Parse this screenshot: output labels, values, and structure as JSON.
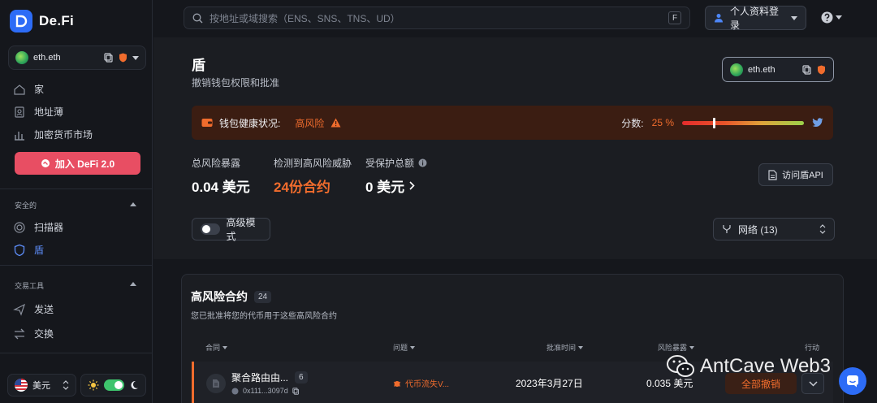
{
  "brand": {
    "name": "De.Fi"
  },
  "account": {
    "name": "eth.eth"
  },
  "search": {
    "placeholder": "按地址或域搜索（ENS、SNS、TNS、UD）",
    "shortcut": "F"
  },
  "header": {
    "login_label": "个人资料登录"
  },
  "sidebar": {
    "nav": [
      {
        "label": "家",
        "icon": "home-icon"
      },
      {
        "label": "地址薄",
        "icon": "address-book-icon"
      },
      {
        "label": "加密货币市场",
        "icon": "bar-chart-icon"
      }
    ],
    "join_label": "加入 DeFi 2.0",
    "security_heading": "安全的",
    "security_items": [
      {
        "label": "扫描器",
        "icon": "scanner-icon"
      },
      {
        "label": "盾",
        "icon": "shield-icon"
      }
    ],
    "trade_heading": "交易工具",
    "trade_items": [
      {
        "label": "发送",
        "icon": "send-icon"
      },
      {
        "label": "交换",
        "icon": "swap-icon"
      }
    ],
    "currency_label": "美元"
  },
  "page": {
    "title": "盾",
    "subtitle": "撤销钱包权限和批准"
  },
  "health": {
    "label": "钱包健康状况:",
    "status": "高风险",
    "score_label": "分数:",
    "score_text": "25 %",
    "score_fraction": 0.25
  },
  "stats": [
    {
      "label": "总风险暴露",
      "value": "0.04 美元"
    },
    {
      "label": "检测到高风险威胁",
      "value": "24份合约"
    },
    {
      "label": "受保护总额",
      "value": "0 美元"
    }
  ],
  "api_label": "访问盾API",
  "advanced_label": "高级模式",
  "network_label": "网络 (13)",
  "contracts": {
    "title": "高风险合约",
    "count": "24",
    "subtitle": "您已批准将您的代币用于这些高风险合约",
    "columns": [
      "合同",
      "问题",
      "批准时间",
      "风险暴露",
      "行动"
    ],
    "row": {
      "name": "聚合路由由...",
      "badge": "6",
      "address": "0x111...3097d",
      "issue": "代币流失V...",
      "time": "2023年3月27日",
      "exposure": "0.035 美元",
      "action": "全部撤销"
    }
  },
  "watermark": {
    "text": "AntCave Web3"
  },
  "colors": {
    "accent": "#2d6cf6",
    "danger": "#f06c2d",
    "join": "#e84e63",
    "toggle_on": "#3ec46d"
  }
}
